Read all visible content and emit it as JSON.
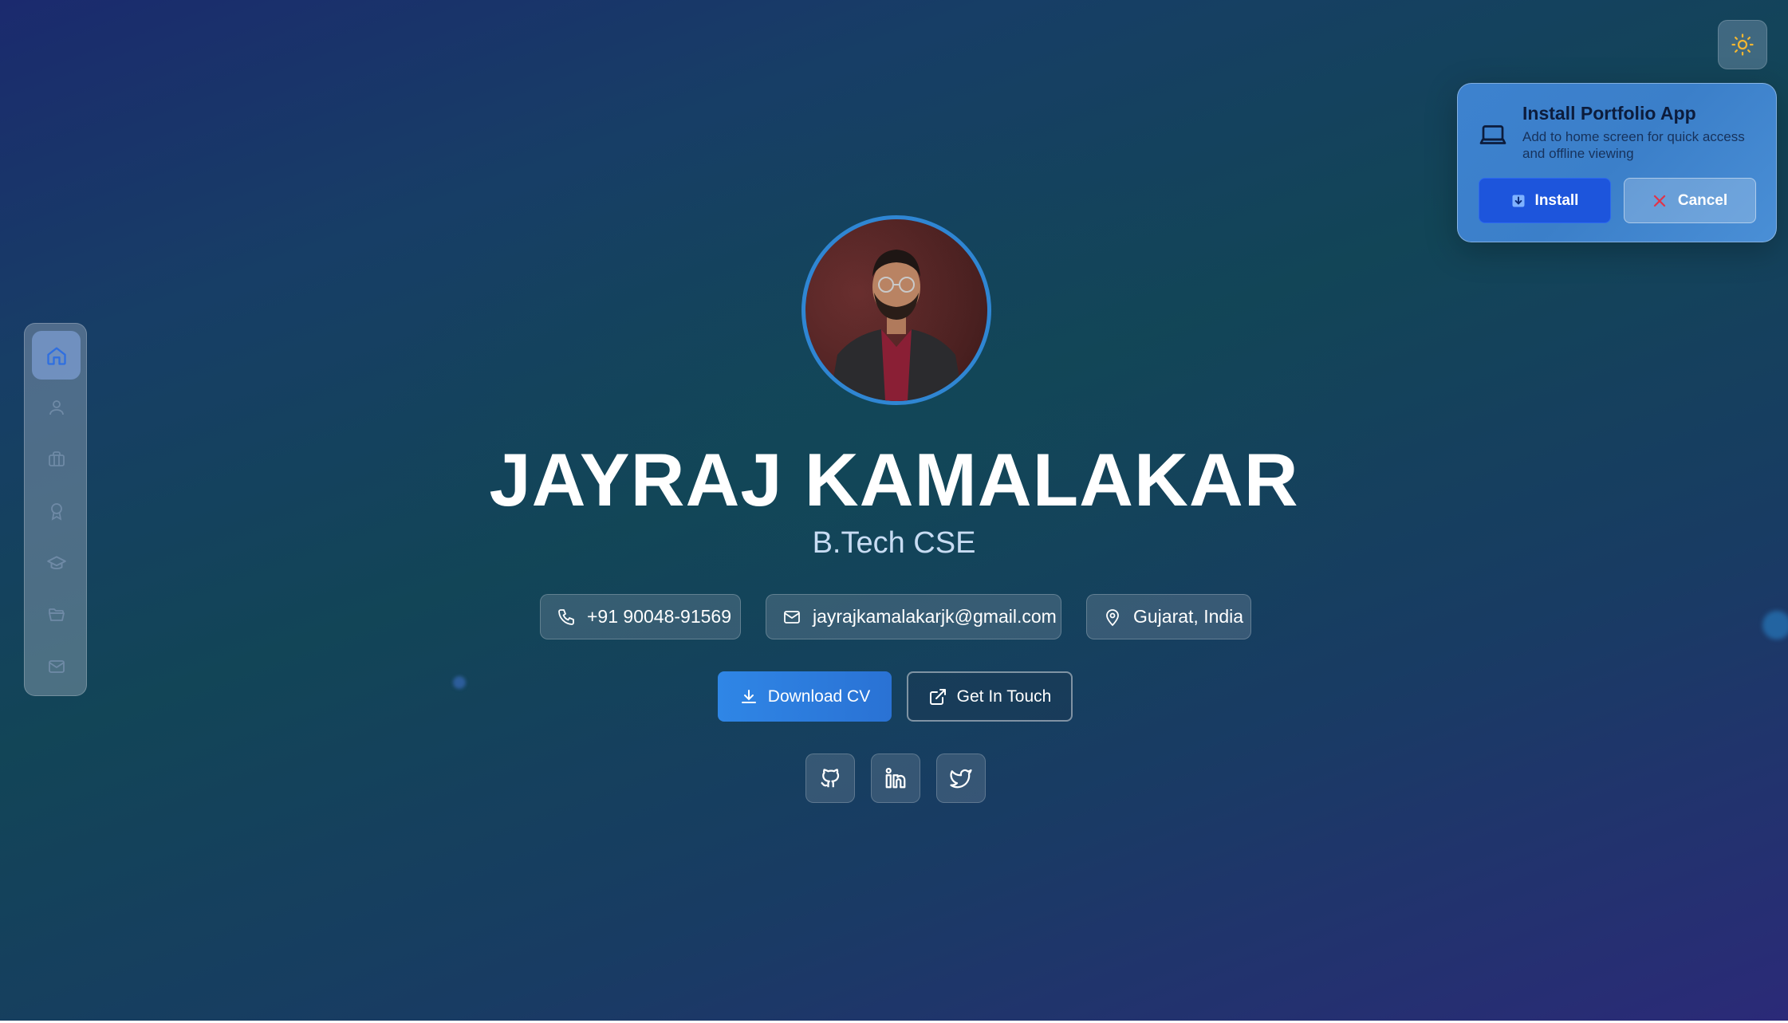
{
  "theme_toggle": {
    "icon": "sun-icon",
    "color": "#f2b632"
  },
  "install_prompt": {
    "title": "Install Portfolio App",
    "description": "Add to home screen for quick access and offline viewing",
    "install_label": "Install",
    "cancel_label": "Cancel",
    "icon": "laptop-icon"
  },
  "sidebar": {
    "items": [
      {
        "name": "home",
        "icon": "home-icon",
        "active": true
      },
      {
        "name": "about",
        "icon": "user-icon",
        "active": false
      },
      {
        "name": "experience",
        "icon": "briefcase-icon",
        "active": false
      },
      {
        "name": "achievements",
        "icon": "award-icon",
        "active": false
      },
      {
        "name": "education",
        "icon": "graduation-cap-icon",
        "active": false
      },
      {
        "name": "projects",
        "icon": "folder-icon",
        "active": false
      },
      {
        "name": "contact",
        "icon": "mail-icon",
        "active": false
      }
    ]
  },
  "hero": {
    "name": "JAYRAJ KAMALAKAR",
    "subtitle": "B.Tech CSE",
    "phone": "+91 90048-91569",
    "email": "jayrajkamalakarjk@gmail.com",
    "location": "Gujarat, India",
    "download_cv_label": "Download CV",
    "get_in_touch_label": "Get In Touch"
  },
  "socials": [
    {
      "name": "github",
      "icon": "github-icon"
    },
    {
      "name": "linkedin",
      "icon": "linkedin-icon"
    },
    {
      "name": "twitter",
      "icon": "twitter-icon"
    }
  ],
  "colors": {
    "accent": "#2f86e6",
    "install_button": "#1d55dc",
    "cancel_x": "#e0344a"
  }
}
